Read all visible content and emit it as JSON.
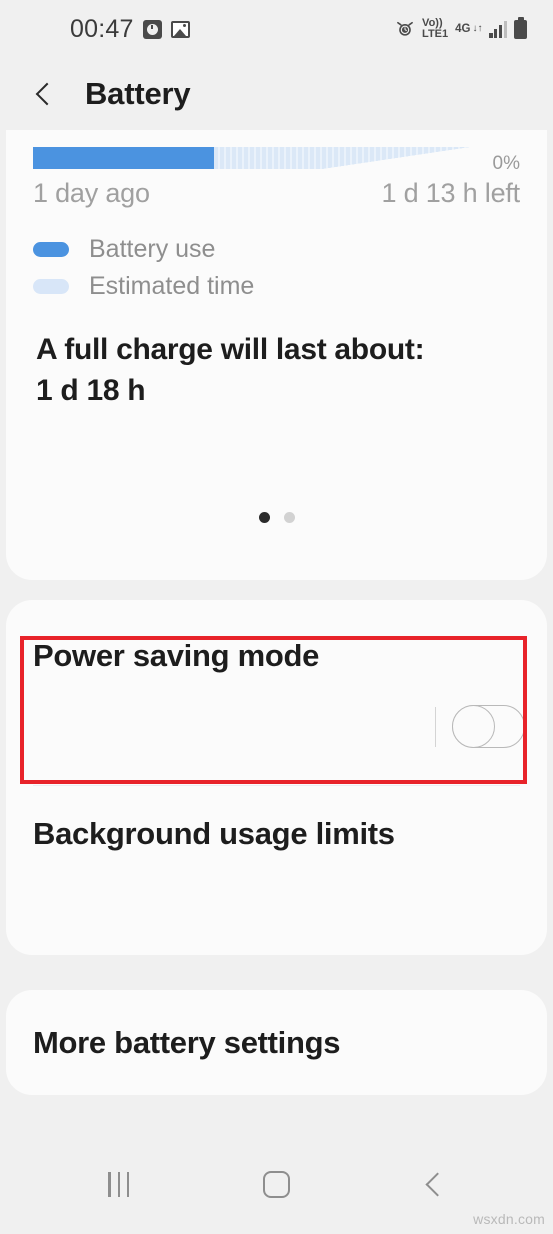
{
  "status_bar": {
    "time": "00:47",
    "left_icons": [
      "clock-square-icon",
      "photo-icon"
    ],
    "right_icons": [
      "alarm-icon",
      "volte-icon",
      "network-4g-icon",
      "signal-bars-icon",
      "battery-icon"
    ],
    "volte_top": "Vo))",
    "volte_bottom": "LTE1",
    "network_type": "4G",
    "network_arrows": "↓↑"
  },
  "app_bar": {
    "back_icon": "back-chevron-icon",
    "title": "Battery"
  },
  "summary_card": {
    "graph": {
      "percent_label": "0%",
      "left_label": "1 day ago",
      "right_label": "1 d 13 h left"
    },
    "legend": [
      {
        "label": "Battery use",
        "color": "#4b93e0"
      },
      {
        "label": "Estimated time",
        "color": "#d8e6f8"
      }
    ],
    "full_charge_heading": "A full charge will last about:",
    "full_charge_value": "1 d 18 h",
    "page_dots": {
      "total": 2,
      "active_index": 0
    }
  },
  "settings_card": {
    "rows": [
      {
        "title": "Power saving mode",
        "toggle": "off",
        "highlighted": true
      },
      {
        "title": "Background usage limits",
        "toggle": null,
        "highlighted": false
      }
    ]
  },
  "more_card": {
    "title": "More battery settings"
  },
  "annotation": {
    "color": "#e8232a",
    "target": "Power saving mode"
  },
  "nav_bar": {
    "recents_label": "recents-icon",
    "home_label": "home-icon",
    "back_label": "back-icon"
  },
  "watermark": "wsxdn.com",
  "chart_data": {
    "type": "bar",
    "title": "Battery level history and estimate",
    "categories": [
      "Battery use",
      "Estimated time"
    ],
    "values": [
      181,
      257
    ],
    "unit": "px-width",
    "annotations": [
      "0%",
      "1 day ago",
      "1 d 13 h left"
    ],
    "ylabel": "",
    "xlabel": ""
  }
}
